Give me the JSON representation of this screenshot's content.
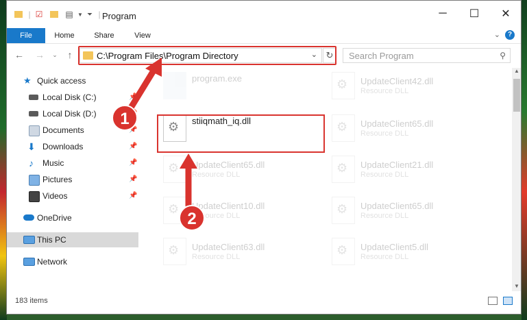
{
  "window": {
    "title": "Program",
    "controls": {
      "minimize": "─",
      "maximize": "☐",
      "close": "✕"
    }
  },
  "ribbon": {
    "tabs": [
      "File",
      "Home",
      "Share",
      "View"
    ],
    "help": "?"
  },
  "address": {
    "path": "C:\\Program Files\\Program Directory",
    "search_placeholder": "Search Program"
  },
  "sidebar": {
    "items": [
      {
        "label": "Quick access",
        "icon": "star-icon",
        "pinned": false
      },
      {
        "label": "Local Disk (C:)",
        "icon": "drive-icon",
        "pinned": true
      },
      {
        "label": "Local Disk (D:)",
        "icon": "drive-icon",
        "pinned": true
      },
      {
        "label": "Documents",
        "icon": "documents-icon",
        "pinned": true
      },
      {
        "label": "Downloads",
        "icon": "download-icon",
        "pinned": true
      },
      {
        "label": "Music",
        "icon": "music-icon",
        "pinned": true
      },
      {
        "label": "Pictures",
        "icon": "pictures-icon",
        "pinned": true
      },
      {
        "label": "Videos",
        "icon": "videos-icon",
        "pinned": true
      },
      {
        "label": "OneDrive",
        "icon": "cloud-icon",
        "pinned": false
      },
      {
        "label": "This PC",
        "icon": "computer-icon",
        "pinned": false,
        "selected": true
      },
      {
        "label": "Network",
        "icon": "network-icon",
        "pinned": false
      }
    ]
  },
  "files": [
    {
      "name": "program.exe",
      "type": "",
      "faded": true
    },
    {
      "name": "UpdateClient42.dll",
      "type": "Resource DLL",
      "faded": true
    },
    {
      "name": "stiiqmath_iq.dll",
      "type": "",
      "faded": false
    },
    {
      "name": "UpdateClient65.dll",
      "type": "Resource DLL",
      "faded": true
    },
    {
      "name": "UpdateClient65.dll",
      "type": "Resource DLL",
      "faded": true
    },
    {
      "name": "UpdateClient21.dll",
      "type": "Resource DLL",
      "faded": true
    },
    {
      "name": "UpdateClient10.dll",
      "type": "Resource DLL",
      "faded": true
    },
    {
      "name": "UpdateClient65.dll",
      "type": "Resource DLL",
      "faded": true
    },
    {
      "name": "UpdateClient63.dll",
      "type": "Resource DLL",
      "faded": true
    },
    {
      "name": "UpdateClient5.dll",
      "type": "Resource DLL",
      "faded": true
    }
  ],
  "status": {
    "item_count": "183 items"
  },
  "annotations": {
    "step1": "1",
    "step2": "2",
    "color": "#d9332e"
  }
}
